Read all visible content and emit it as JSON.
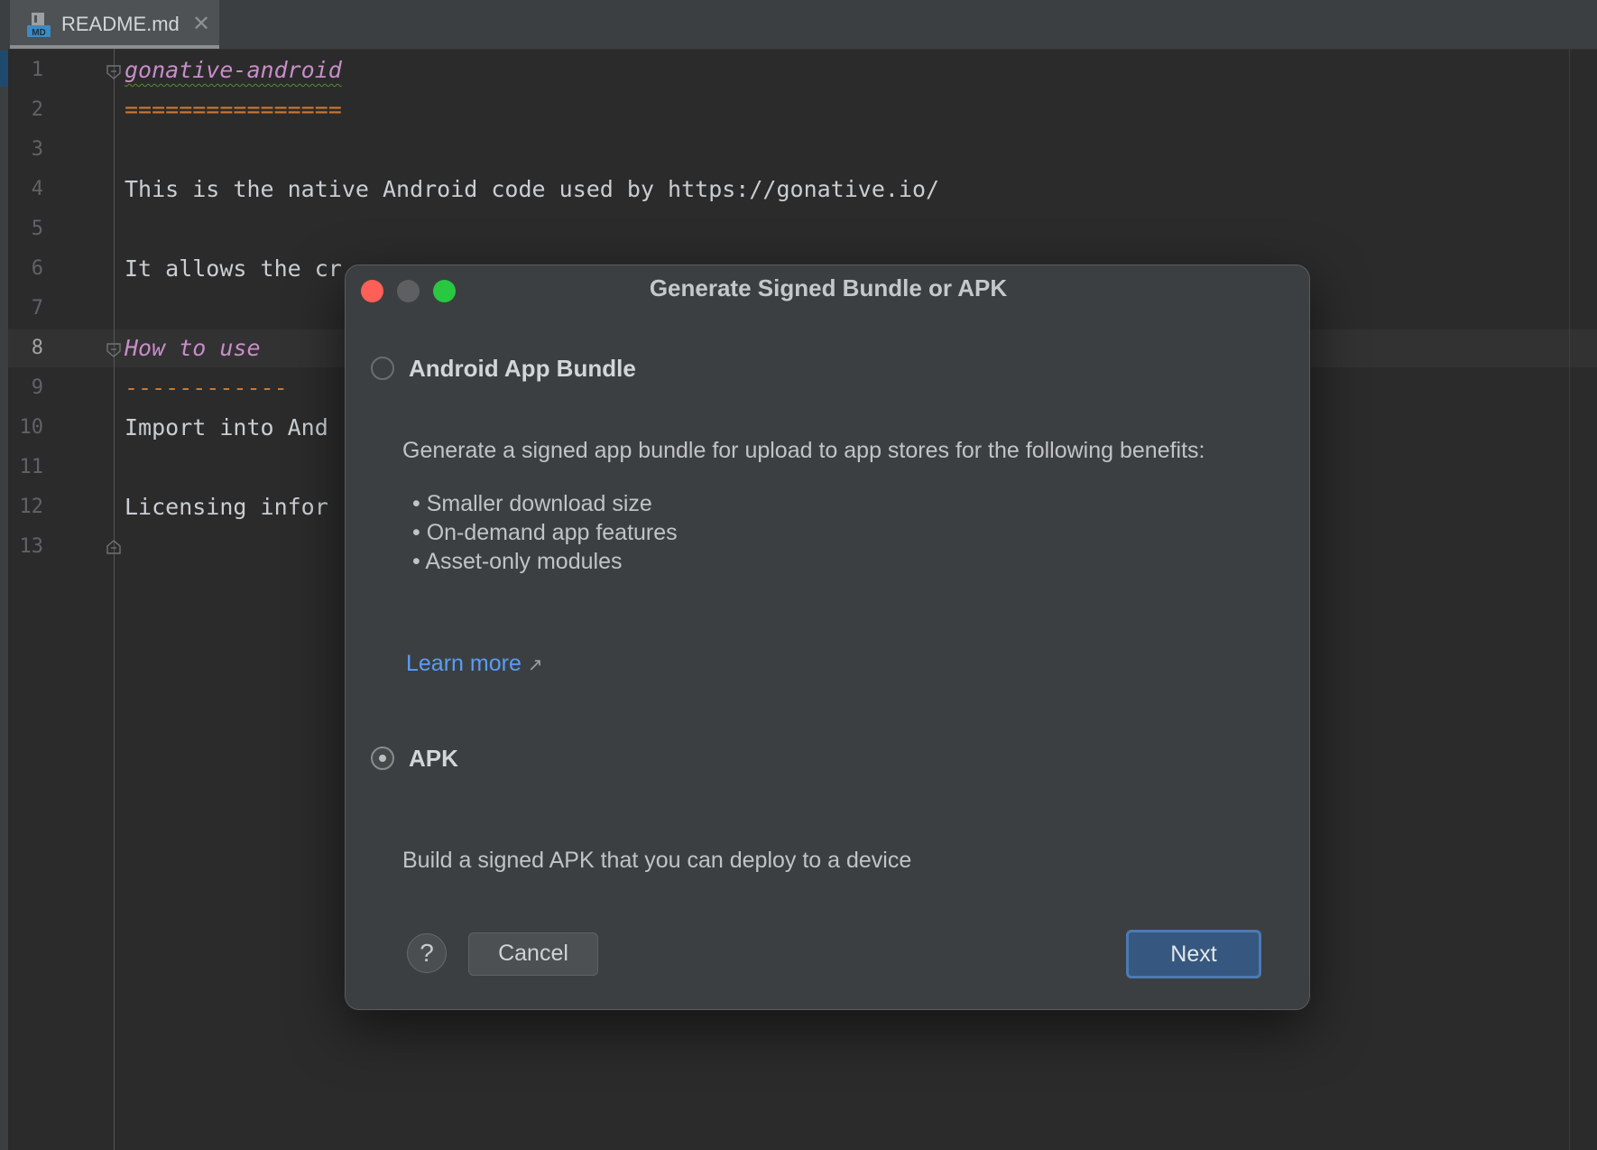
{
  "editor": {
    "tab": {
      "icon": "markdown-file-icon",
      "icon_text": "MD",
      "label": "README.md",
      "close_glyph": "✕"
    },
    "line_numbers": [
      "1",
      "2",
      "3",
      "4",
      "5",
      "6",
      "7",
      "8",
      "9",
      "10",
      "11",
      "12",
      "13"
    ],
    "current_line": "8",
    "lines": {
      "l1": "gonative-android",
      "l2": "================",
      "l4": "This is the native Android code used by https://gonative.io/",
      "l6": "It allows the cr",
      "l8": "How to use",
      "l9": "------------",
      "l10": "Import into And",
      "l12": "Licensing infor"
    }
  },
  "dialog": {
    "title": "Generate Signed Bundle or APK",
    "bundle": {
      "label": "Android App Bundle",
      "selected": false,
      "description": "Generate a signed app bundle for upload to app stores for the following benefits:",
      "benefits": [
        "Smaller download size",
        "On-demand app features",
        "Asset-only modules"
      ],
      "learn_more": "Learn more",
      "learn_more_glyph": "↗"
    },
    "apk": {
      "label": "APK",
      "selected": true,
      "description": "Build a signed APK that you can deploy to a device"
    },
    "buttons": {
      "help": "?",
      "cancel": "Cancel",
      "next": "Next"
    }
  },
  "colors": {
    "editor_bg": "#2b2b2b",
    "dialog_bg": "#3c3f41",
    "link": "#589df6",
    "primary_button": "#365880",
    "heading_text": "#c98dca",
    "rule_text": "#cc7832"
  }
}
